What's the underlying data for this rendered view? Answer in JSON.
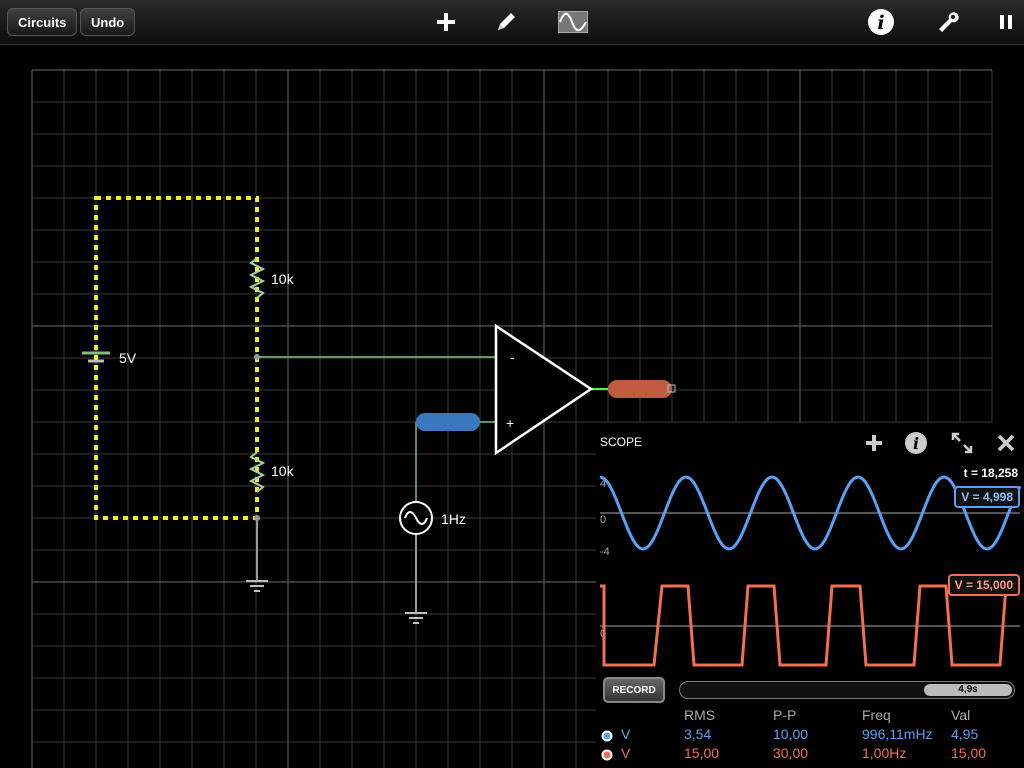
{
  "toolbar": {
    "circuits_label": "Circuits",
    "undo_label": "Undo"
  },
  "circuit": {
    "battery_label": "5V",
    "r1_label": "10k",
    "r2_label": "10k",
    "source_label": "1Hz",
    "opamp_minus": "-",
    "opamp_plus": "+"
  },
  "scope": {
    "title": "SCOPE",
    "time_readout": "t = 18,258",
    "ch1_value": "V = 4,998",
    "ch2_value": "V = 15,000",
    "ch1_ticks": [
      "4",
      "0",
      "-4"
    ],
    "ch2_tick": "0",
    "record_label": "RECORD",
    "time_window": "4,9s",
    "table": {
      "headers": [
        "RMS",
        "P-P",
        "Freq",
        "Val"
      ],
      "rows": [
        {
          "name": "V",
          "rms": "3,54",
          "pp": "10,00",
          "freq": "996,11mHz",
          "val": "4,95"
        },
        {
          "name": "V",
          "rms": "15,00",
          "pp": "30,00",
          "freq": "1,00Hz",
          "val": "15,00"
        }
      ]
    }
  },
  "colors": {
    "ch1": "#5aa0f0",
    "ch2": "#f07050",
    "grid": "#3a3a3a",
    "selection": "#f0f020"
  }
}
